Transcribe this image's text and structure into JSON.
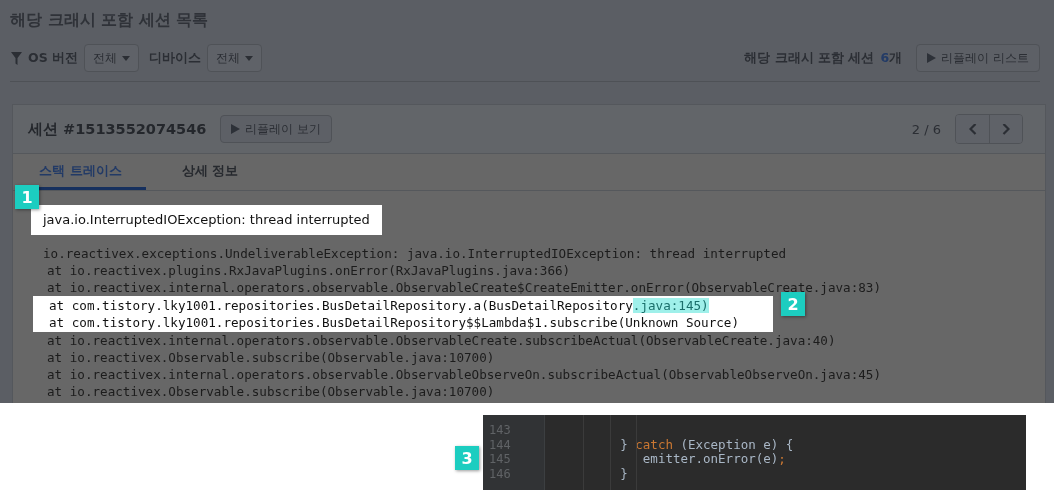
{
  "page_title": "해당 크래시 포함 세션 목록",
  "filters": [
    {
      "label": "OS 버전",
      "value": "전체"
    },
    {
      "label": "디바이스",
      "value": "전체"
    }
  ],
  "session_count": {
    "label": "해당 크래시 포함 세션",
    "count": "6",
    "unit": "개"
  },
  "replay_list_button": "리플레이 리스트",
  "session": {
    "title": "세션 #1513552074546",
    "replay_button": "리플레이 보기",
    "pager": "2 / 6"
  },
  "tabs": [
    {
      "label": "스택 트레이스",
      "selected": true
    },
    {
      "label": "상세 정보",
      "selected": false
    }
  ],
  "exception_title": {
    "text": "java.io.InterruptedIOException: thread interrupted",
    "highlighted": true
  },
  "stack_lines": [
    {
      "kind": "exception",
      "text": "io.reactivex.exceptions.UndeliverableException: java.io.InterruptedIOException: thread interrupted",
      "highlighted": false
    },
    {
      "kind": "frame",
      "text": "at io.reactivex.plugins.RxJavaPlugins.onError(RxJavaPlugins.java:366)",
      "highlighted": false
    },
    {
      "kind": "frame",
      "text": "at io.reactivex.internal.operators.observable.ObservableCreate$CreateEmitter.onError(ObservableCreate.java:83)",
      "highlighted": false
    },
    {
      "kind": "frame",
      "text": "at com.tistory.lky1001.repositories.BusDetailRepository.a(BusDetailRepository",
      "marked_text": ".java:145)",
      "highlighted": true
    },
    {
      "kind": "frame",
      "text": "at com.tistory.lky1001.repositories.BusDetailRepository$$Lambda$1.subscribe(Unknown Source)",
      "highlighted": true
    },
    {
      "kind": "frame",
      "text": "at io.reactivex.internal.operators.observable.ObservableCreate.subscribeActual(ObservableCreate.java:40)",
      "highlighted": false
    },
    {
      "kind": "frame",
      "text": "at io.reactivex.Observable.subscribe(Observable.java:10700)",
      "highlighted": false
    },
    {
      "kind": "frame",
      "text": "at io.reactivex.internal.operators.observable.ObservableObserveOn.subscribeActual(ObservableObserveOn.java:45)",
      "highlighted": false
    },
    {
      "kind": "frame",
      "text": "at io.reactivex.Observable.subscribe(Observable.java:10700)",
      "highlighted": false
    }
  ],
  "callouts": [
    "1",
    "2",
    "3"
  ],
  "code_lines": [
    {
      "number": "143"
    },
    {
      "number": "144",
      "tokens": [
        {
          "kind": "plain",
          "text": "          } "
        },
        {
          "kind": "keyword",
          "text": "catch"
        },
        {
          "kind": "plain",
          "text": " (Exception e) {"
        }
      ]
    },
    {
      "number": "145",
      "tokens": [
        {
          "kind": "plain",
          "text": "             emitter.onError(e)"
        },
        {
          "kind": "keyword",
          "text": ";"
        }
      ]
    },
    {
      "number": "146",
      "tokens": [
        {
          "kind": "plain",
          "text": "          }"
        }
      ]
    }
  ]
}
